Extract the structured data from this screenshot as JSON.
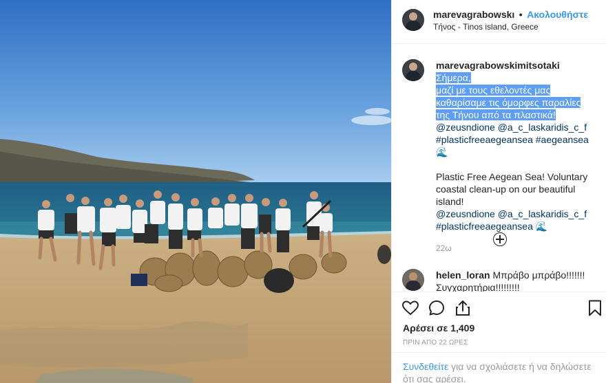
{
  "header": {
    "username": "marevagrabowskı",
    "separator": "•",
    "follow_label": "Ακολουθήστε",
    "location": "Τήνος - Tinos island, Greece"
  },
  "caption": {
    "username": "marevagrabowskimitsotaki",
    "text_greek_highlighted": [
      "Σήμερα,",
      "μαζί με τους εθελοντές μας",
      "καθαρίσαμε τις όμορφες παραλίες",
      "της Τήνου από τα πλαστικά!"
    ],
    "mentions": "@zeusndione @a_c_laskaridis_c_f",
    "hashtags": "#plasticfreeaegeansea #aegeansea",
    "emoji_1": "🌊",
    "english_lines": [
      "Plastic Free Aegean Sea! Voluntary",
      "coastal clean-up on our beautiful",
      "island!"
    ],
    "mentions_2": "@zeusndione @a_c_laskaridis_c_f",
    "hashtags_2": "#plasticfreeaegeansea",
    "emoji_2": "🌊",
    "age": "22ω"
  },
  "comment": {
    "username": "helen_loran",
    "text_1": "Μπράβο μπράβο!!!!!!!",
    "text_2": "Συγχαρητήρια!!!!!!!!!"
  },
  "actions": {
    "icons": [
      "heart-icon",
      "comment-icon",
      "share-icon",
      "bookmark-icon"
    ],
    "likes": "Αρέσει σε 1,409",
    "posted": "ΠΡΙΝ ΑΠΟ 22 ΩΡΕΣ"
  },
  "login": {
    "link": "Συνδεθείτε",
    "text": " για να σχολιάσετε ή να δηλώσετε ότι σας αρέσει."
  },
  "colors": {
    "link_blue": "#3897f0",
    "highlight": "#5c9ef8",
    "tag_blue": "#003569",
    "muted": "#999999"
  }
}
